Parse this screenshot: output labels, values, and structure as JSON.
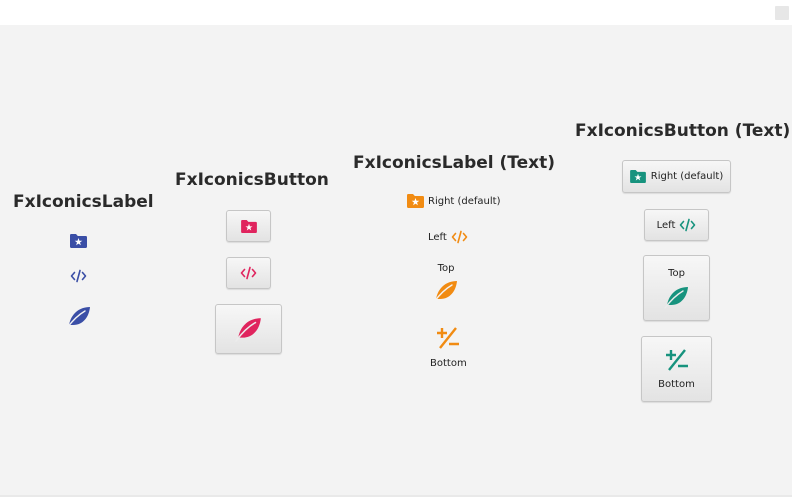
{
  "headings": {
    "fxiconics_label": "FxIconicsLabel",
    "fxiconics_button": "FxIconicsButton",
    "fxiconics_label_text": "FxIconicsLabel (Text)",
    "fxiconics_button_text": "FxIconicsButton (Text)"
  },
  "label_text": {
    "right": "Right (default)",
    "left": "Left",
    "top": "Top",
    "bottom": "Bottom"
  },
  "button_text": {
    "right": "Right (default)",
    "left": "Left",
    "top": "Top",
    "bottom": "Bottom"
  },
  "colors": {
    "indigo": "#3a4ea6",
    "pink": "#e0245e",
    "orange": "#f18b12",
    "teal": "#17937e",
    "background": "#f3f3f3"
  },
  "icons": [
    "folder-star-icon",
    "code-icon",
    "leaf-icon",
    "plus-minus-icon"
  ]
}
